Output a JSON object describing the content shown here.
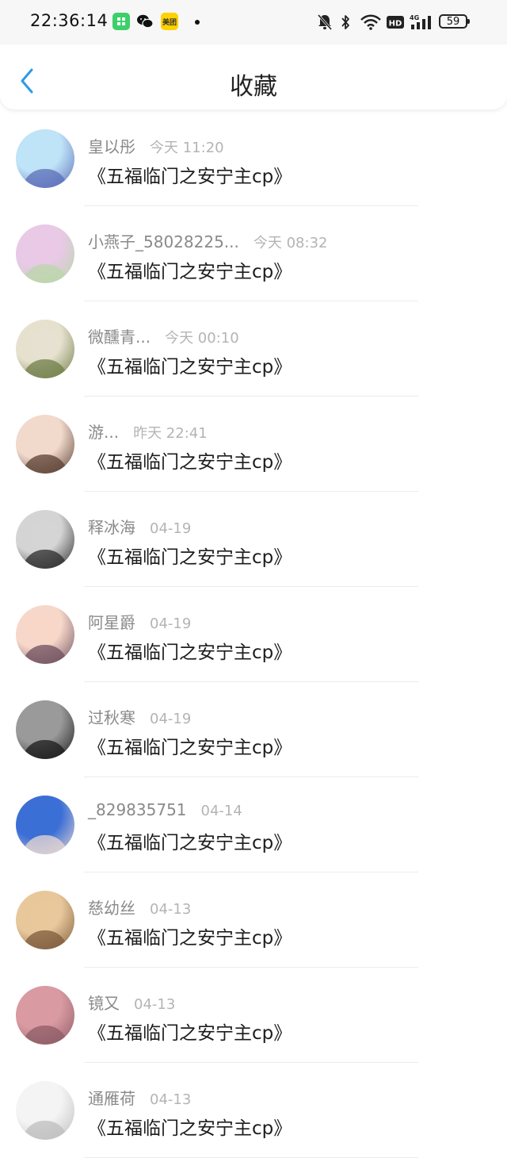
{
  "status_bar": {
    "time": "22:36:14",
    "meituan_label": "美团",
    "battery": "59",
    "icons": [
      "app-green-icon",
      "wechat-icon",
      "meituan-icon",
      "dot-icon",
      "mute-bell-icon",
      "bluetooth-icon",
      "wifi-icon",
      "hd-icon",
      "signal-4g-icon",
      "battery-icon"
    ]
  },
  "header": {
    "title": "收藏",
    "back_icon": "chevron-left-icon",
    "accent_color": "#2e9be6"
  },
  "items": [
    {
      "name": "皇以彤",
      "time": "今天 11:20",
      "title": "《五福临门之安宁主cp》",
      "avatar_colors": [
        "#bfe3f7",
        "#5b6db8"
      ]
    },
    {
      "name": "小燕子_58028225...",
      "time": "今天 08:32",
      "title": "《五福临门之安宁主cp》",
      "avatar_colors": [
        "#e8c9e6",
        "#b9d7a9"
      ]
    },
    {
      "name": "微醺青...",
      "time": "今天 00:10",
      "title": "《五福临门之安宁主cp》",
      "avatar_colors": [
        "#e6e1cf",
        "#6f7d47"
      ]
    },
    {
      "name": "游...",
      "time": "昨天 22:41",
      "title": "《五福临门之安宁主cp》",
      "avatar_colors": [
        "#f1d9cc",
        "#5a4033"
      ]
    },
    {
      "name": "释冰海",
      "time": "04-19",
      "title": "《五福临门之安宁主cp》",
      "avatar_colors": [
        "#d4d4d4",
        "#2b2b2b"
      ]
    },
    {
      "name": "阿星爵",
      "time": "04-19",
      "title": "《五福临门之安宁主cp》",
      "avatar_colors": [
        "#f7d7c9",
        "#6d4f5e"
      ]
    },
    {
      "name": "过秋寒",
      "time": "04-19",
      "title": "《五福临门之安宁主cp》",
      "avatar_colors": [
        "#9a9a9a",
        "#1a1a1a"
      ]
    },
    {
      "name": "_829835751",
      "time": "04-14",
      "title": "《五福临门之安宁主cp》",
      "avatar_colors": [
        "#3b6fd6",
        "#e9d8d2"
      ]
    },
    {
      "name": "慈幼丝",
      "time": "04-13",
      "title": "《五福临门之安宁主cp》",
      "avatar_colors": [
        "#e8c89b",
        "#7d5b3c"
      ]
    },
    {
      "name": "镜又",
      "time": "04-13",
      "title": "《五福临门之安宁主cp》",
      "avatar_colors": [
        "#d99aa2",
        "#8d5c66"
      ]
    },
    {
      "name": "通雁荷",
      "time": "04-13",
      "title": "《五福临门之安宁主cp》",
      "avatar_colors": [
        "#f4f4f4",
        "#bdbdbd"
      ]
    }
  ]
}
